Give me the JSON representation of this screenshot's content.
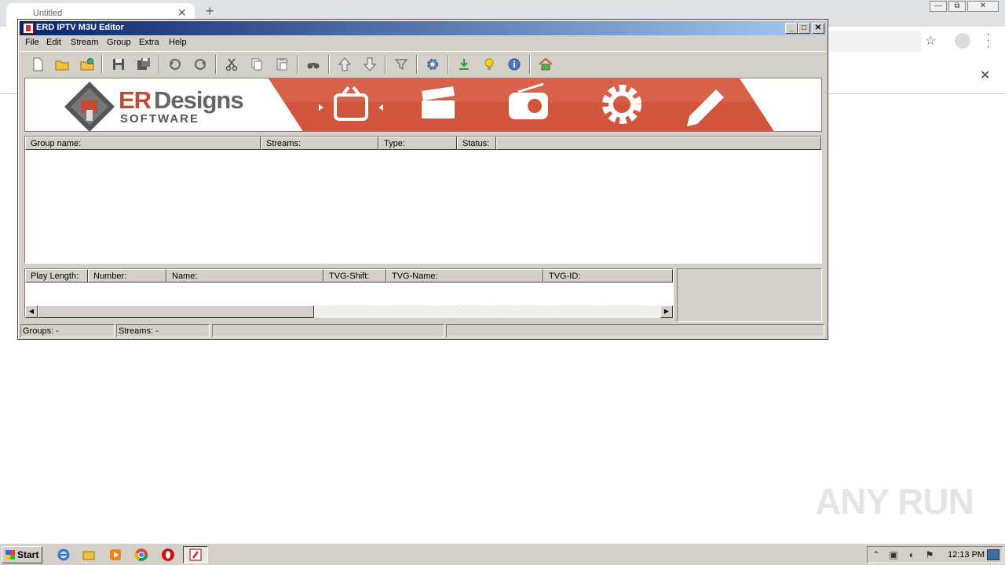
{
  "browser": {
    "tab_title": "Untitled",
    "tab_close": "✕",
    "new_tab": "+",
    "window_min": "—",
    "window_restore": "⧉",
    "window_close": "✕",
    "star": "☆",
    "infobar_close": "✕"
  },
  "app": {
    "title": "ERD IPTV M3U Editor",
    "min": "_",
    "max": "□",
    "close": "✕"
  },
  "menu": [
    "File",
    "Edit",
    "Stream",
    "Group",
    "Extra",
    "Help"
  ],
  "banner": {
    "logo_er": "ER",
    "logo_designs": "Designs",
    "logo_sub": "SOFTWARE"
  },
  "group_list": {
    "columns": [
      "Group name:",
      "Streams:",
      "Type:",
      "Status:"
    ]
  },
  "stream_list": {
    "columns": [
      "Play Length:",
      "Number:",
      "Name:",
      "TVG-Shift:",
      "TVG-Name:",
      "TVG-ID:"
    ]
  },
  "scroll": {
    "left": "◀",
    "right": "▶"
  },
  "status": {
    "groups": "Groups: -",
    "streams": "Streams: -"
  },
  "watermark": "ANY RUN",
  "taskbar": {
    "start": "Start",
    "clock": "12:13 PM"
  }
}
